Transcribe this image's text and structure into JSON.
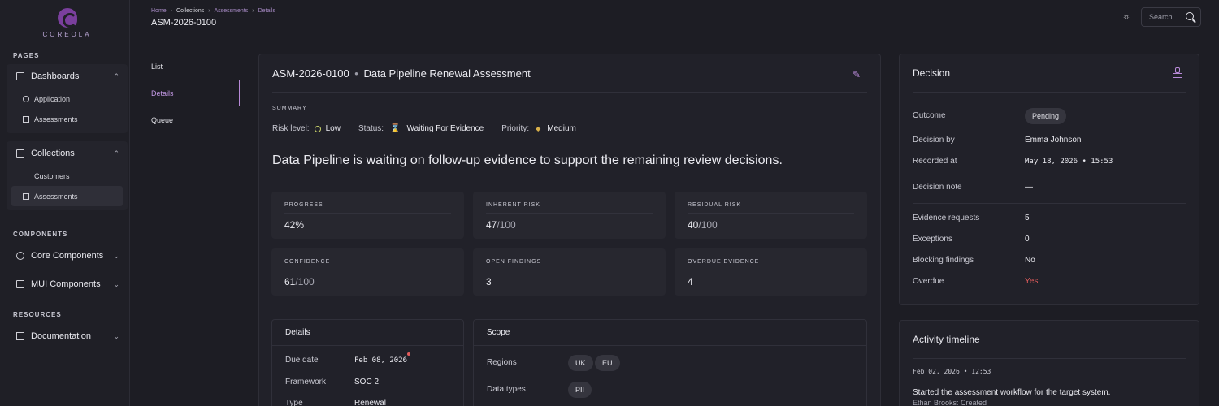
{
  "brand": {
    "name": "COREOLA"
  },
  "sidebar": {
    "pages_label": "PAGES",
    "components_label": "COMPONENTS",
    "resources_label": "RESOURCES",
    "dashboards": {
      "label": "Dashboards",
      "items": [
        {
          "label": "Application"
        },
        {
          "label": "Assessments"
        }
      ]
    },
    "collections": {
      "label": "Collections",
      "items": [
        {
          "label": "Customers"
        },
        {
          "label": "Assessments"
        }
      ]
    },
    "core_components": {
      "label": "Core Components"
    },
    "mui_components": {
      "label": "MUI Components"
    },
    "documentation": {
      "label": "Documentation"
    }
  },
  "breadcrumb": [
    "Home",
    "Collections",
    "Assessments",
    "Details"
  ],
  "page_title": "ASM-2026-0100",
  "search": {
    "placeholder": "Search"
  },
  "tabs": [
    {
      "label": "List"
    },
    {
      "label": "Details"
    },
    {
      "label": "Queue"
    }
  ],
  "assessment": {
    "id": "ASM-2026-0100",
    "name": "Data Pipeline Renewal Assessment",
    "summary_label": "SUMMARY",
    "risk_level_label": "Risk level:",
    "risk_level": "Low",
    "status_label": "Status:",
    "status": "Waiting For Evidence",
    "priority_label": "Priority:",
    "priority": "Medium",
    "headline": "Data Pipeline is waiting on follow-up evidence to support the remaining review decisions."
  },
  "metrics": [
    {
      "label": "PROGRESS",
      "value": "42%",
      "denominator": ""
    },
    {
      "label": "INHERENT RISK",
      "value": "47",
      "denominator": "/100"
    },
    {
      "label": "RESIDUAL RISK",
      "value": "40",
      "denominator": "/100"
    },
    {
      "label": "CONFIDENCE",
      "value": "61",
      "denominator": "/100"
    },
    {
      "label": "OPEN FINDINGS",
      "value": "3",
      "denominator": ""
    },
    {
      "label": "OVERDUE EVIDENCE",
      "value": "4",
      "denominator": ""
    }
  ],
  "details": {
    "title": "Details",
    "due_date_label": "Due date",
    "due_date": "Feb 08, 2026",
    "framework_label": "Framework",
    "framework": "SOC 2",
    "type_label": "Type",
    "type": "Renewal"
  },
  "scope": {
    "title": "Scope",
    "regions_label": "Regions",
    "regions": [
      "UK",
      "EU"
    ],
    "data_types_label": "Data types",
    "data_types": [
      "PII"
    ]
  },
  "decision": {
    "title": "Decision",
    "outcome_label": "Outcome",
    "outcome": "Pending",
    "decision_by_label": "Decision by",
    "decision_by": "Emma Johnson",
    "recorded_at_label": "Recorded at",
    "recorded_at": "May 18, 2026 • 15:53",
    "note_label": "Decision note",
    "note": "—",
    "evidence_requests_label": "Evidence requests",
    "evidence_requests": "5",
    "exceptions_label": "Exceptions",
    "exceptions": "0",
    "blocking_findings_label": "Blocking findings",
    "blocking_findings": "No",
    "overdue_label": "Overdue",
    "overdue": "Yes"
  },
  "activity": {
    "title": "Activity timeline",
    "events": [
      {
        "timestamp": "Feb 02, 2026 • 12:53",
        "text": "Started the assessment workflow for the target system.",
        "meta": "Ethan Brooks: Created"
      }
    ]
  }
}
